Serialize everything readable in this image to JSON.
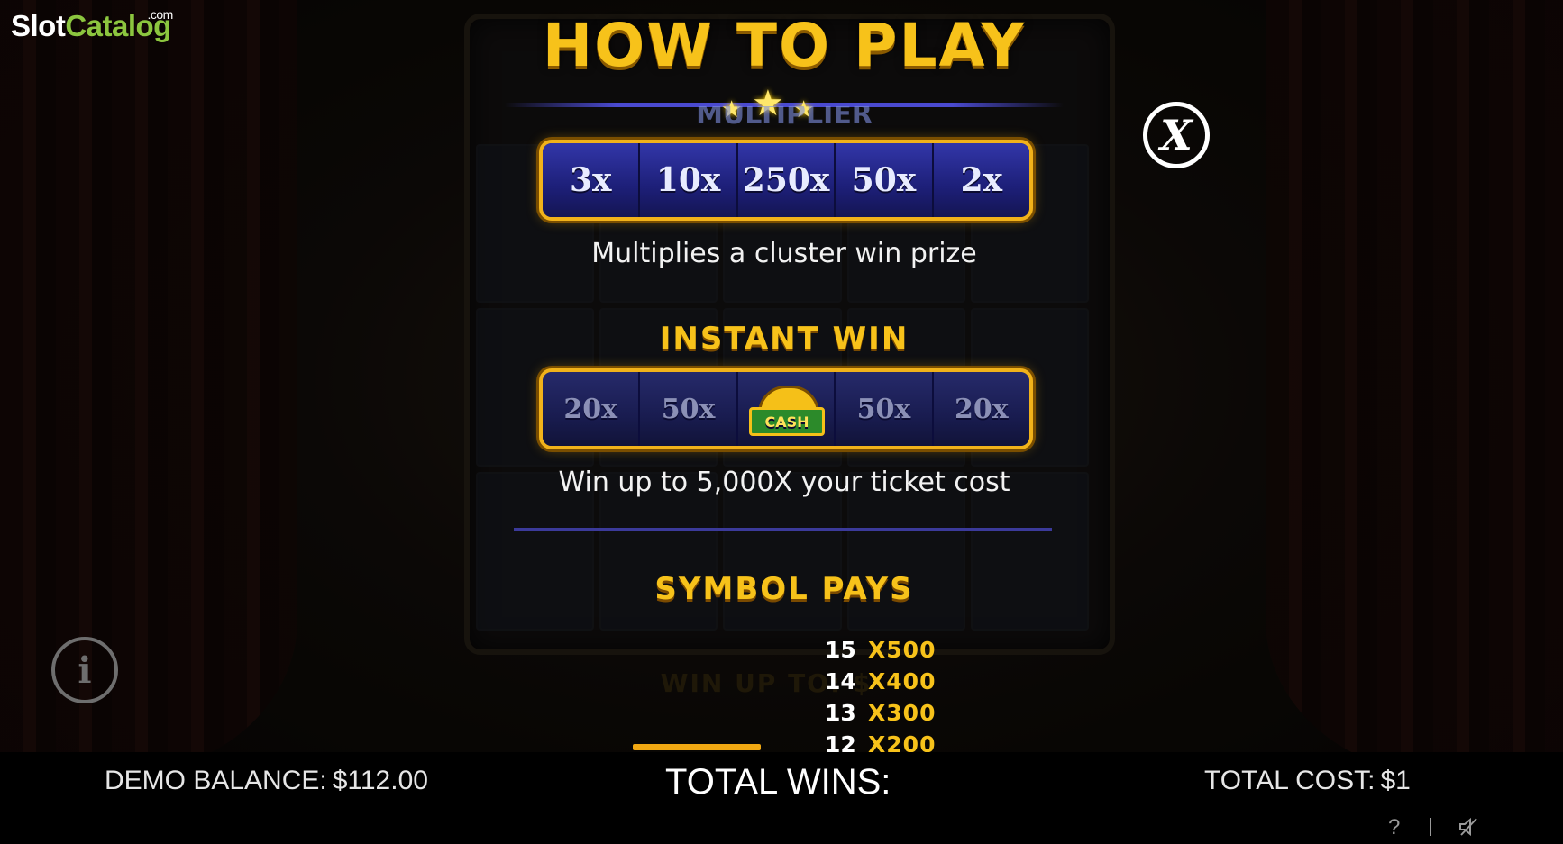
{
  "brand": {
    "slot": "Slot",
    "catalog": "Catalog",
    "com": ".com"
  },
  "header": {
    "title": "HOW TO PLAY",
    "partial_section_title": "MULTIPLIER"
  },
  "multiplier": {
    "values": [
      "3x",
      "10x",
      "250x",
      "50x",
      "2x"
    ],
    "description": "Multiplies a cluster win prize"
  },
  "instant_win": {
    "title": "INSTANT WIN",
    "values": [
      "20x",
      "50x",
      "CASH",
      "50x",
      "20x"
    ],
    "description": "Win up to 5,000X your ticket cost"
  },
  "symbol_pays": {
    "title": "SYMBOL PAYS",
    "rows": [
      {
        "count": "15",
        "multiplier": "X500"
      },
      {
        "count": "14",
        "multiplier": "X400"
      },
      {
        "count": "13",
        "multiplier": "X300"
      },
      {
        "count": "12",
        "multiplier": "X200"
      }
    ]
  },
  "background_text": "WIN UP TO: $",
  "footer": {
    "demo_balance_label": "DEMO BALANCE:",
    "demo_balance_value": "$112.00",
    "total_wins_label": "TOTAL WINS:",
    "total_cost_label": "TOTAL COST:",
    "total_cost_value": "$1",
    "help": "?"
  },
  "icons": {
    "close": "close-icon",
    "info": "info-icon",
    "help": "help-icon",
    "sound": "sound-muted-icon"
  },
  "colors": {
    "gold": "#f7c21a",
    "blue_frame": "#1d1f78",
    "brand_green": "#8cc63f"
  }
}
